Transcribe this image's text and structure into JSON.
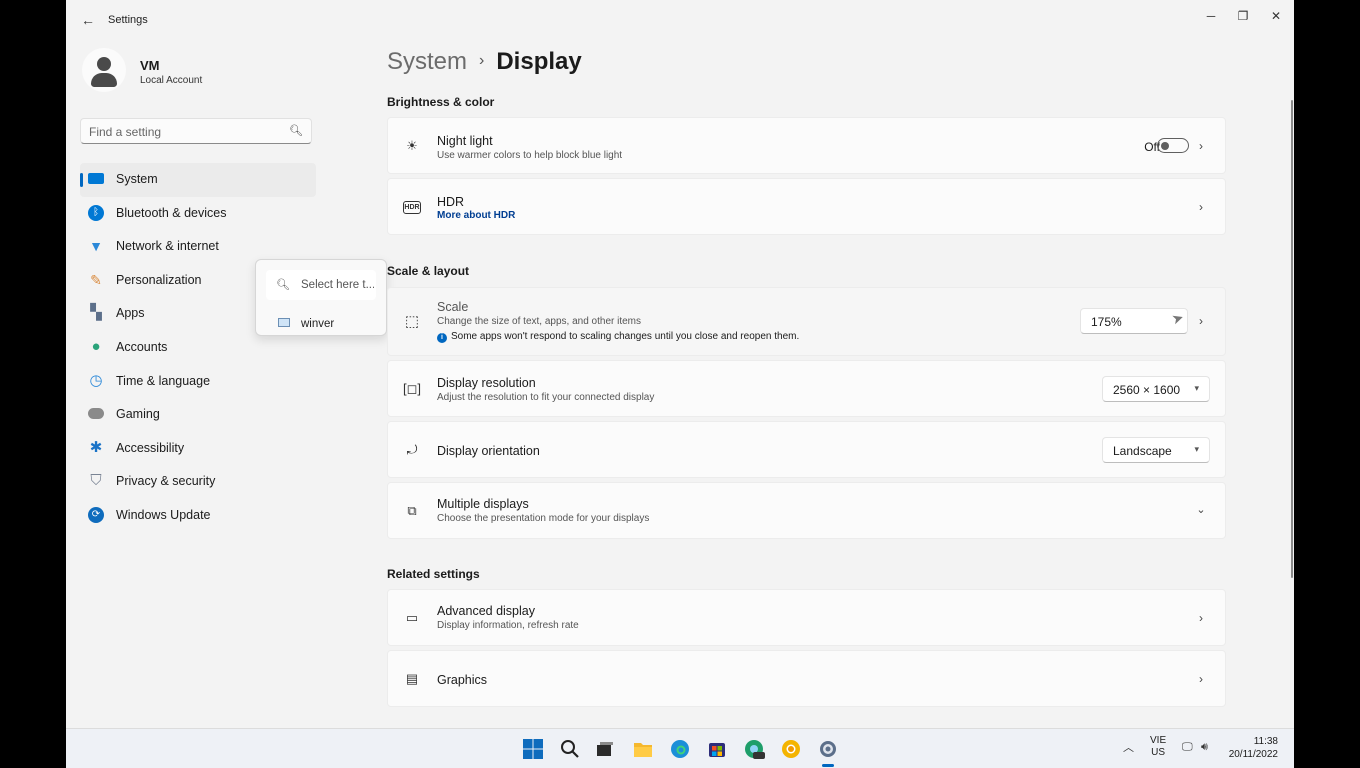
{
  "window": {
    "title": "Settings"
  },
  "user": {
    "name": "VM",
    "account_type": "Local Account"
  },
  "search": {
    "placeholder": "Find a setting"
  },
  "sidebar": {
    "items": [
      {
        "label": "System",
        "icon": "system-icon",
        "color": "#0078d4",
        "selected": true
      },
      {
        "label": "Bluetooth & devices",
        "icon": "bluetooth-icon",
        "color": "#0078d4"
      },
      {
        "label": "Network & internet",
        "icon": "wifi-icon",
        "color": "#2b88d8"
      },
      {
        "label": "Personalization",
        "icon": "brush-icon",
        "color": "#d98a3d"
      },
      {
        "label": "Apps",
        "icon": "apps-icon",
        "color": "#5c6f8a"
      },
      {
        "label": "Accounts",
        "icon": "accounts-icon",
        "color": "#2aa37a"
      },
      {
        "label": "Time & language",
        "icon": "clock-globe-icon",
        "color": "#2b88d8"
      },
      {
        "label": "Gaming",
        "icon": "gamepad-icon",
        "color": "#7a7a7a"
      },
      {
        "label": "Accessibility",
        "icon": "accessibility-icon",
        "color": "#1a73c7"
      },
      {
        "label": "Privacy & security",
        "icon": "shield-icon",
        "color": "#7a8494"
      },
      {
        "label": "Windows Update",
        "icon": "update-icon",
        "color": "#0f6cbd"
      }
    ]
  },
  "popup": {
    "search_placeholder": "Select here t...",
    "result_label": "winver"
  },
  "breadcrumb": {
    "parent": "System",
    "separator": "›",
    "current": "Display"
  },
  "sections": {
    "brightness": "Brightness & color",
    "scale_layout": "Scale & layout",
    "related": "Related settings"
  },
  "cards": {
    "night_light": {
      "title": "Night light",
      "subtitle": "Use warmer colors to help block blue light",
      "toggle_label": "Off",
      "toggle_on": false
    },
    "hdr": {
      "title": "HDR",
      "link": "More about HDR"
    },
    "scale": {
      "title": "Scale",
      "subtitle": "Change the size of text, apps, and other items",
      "warning": "Some apps won't respond to scaling changes until you close and reopen them.",
      "value": "175%"
    },
    "resolution": {
      "title": "Display resolution",
      "subtitle": "Adjust the resolution to fit your connected display",
      "value": "2560 × 1600"
    },
    "orientation": {
      "title": "Display orientation",
      "value": "Landscape"
    },
    "multiple": {
      "title": "Multiple displays",
      "subtitle": "Choose the presentation mode for your displays"
    },
    "advanced": {
      "title": "Advanced display",
      "subtitle": "Display information, refresh rate"
    },
    "graphics": {
      "title": "Graphics"
    }
  },
  "tray": {
    "lang_line1": "VIE",
    "lang_line2": "US",
    "time": "11:38",
    "date": "20/11/2022"
  },
  "colors": {
    "accent": "#0067c0",
    "window_bg": "#f3f3f3",
    "card_bg": "#fbfbfb"
  }
}
